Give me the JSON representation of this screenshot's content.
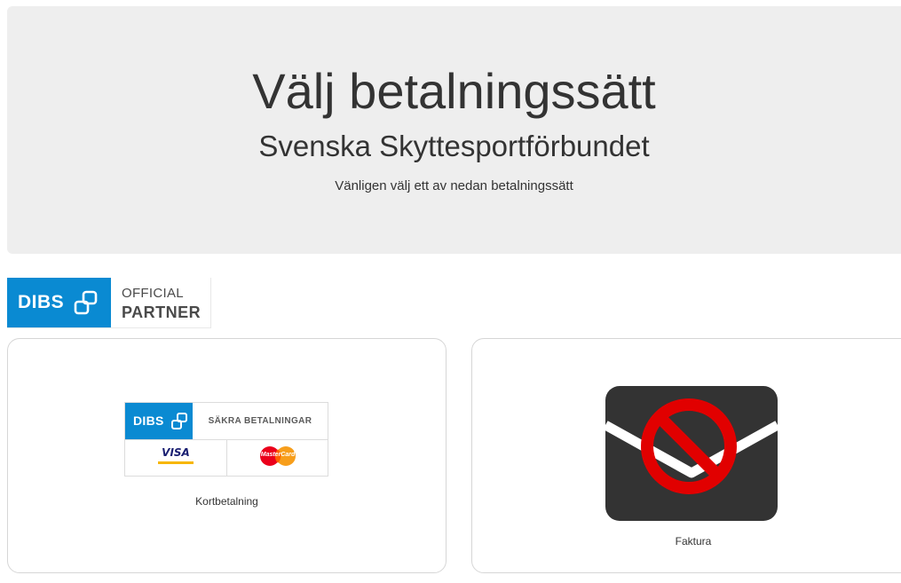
{
  "header": {
    "title": "Välj betalningssätt",
    "organization": "Svenska Skyttesportförbundet",
    "instruction": "Vänligen välj ett av nedan betalningssätt"
  },
  "partner_logo": {
    "brand": "DIBS",
    "line1": "OFFICIAL",
    "line2": "PARTNER",
    "color": "#0a8ad2"
  },
  "payment_methods": [
    {
      "label": "Kortbetalning",
      "badge": {
        "brand": "DIBS",
        "tagline": "SÄKRA BETALNINGAR",
        "visa": "VISA",
        "mastercard": "MasterCard"
      },
      "icon": "dibs-card-badge"
    },
    {
      "label": "Faktura",
      "icon": "envelope-prohibited-icon",
      "status": "unavailable"
    }
  ],
  "colors": {
    "hero_background": "#eeeeee",
    "dibs_blue": "#0a8ad2",
    "prohibit_red": "#e10000",
    "envelope": "#333333"
  }
}
